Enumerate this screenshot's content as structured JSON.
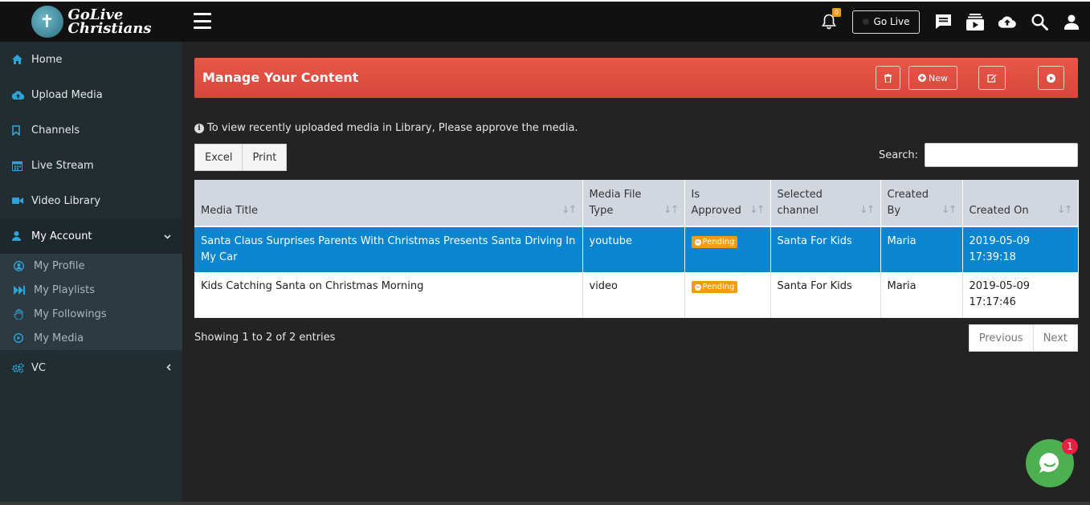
{
  "brand": {
    "logo_line1": "GoLive",
    "logo_line2": "Christians"
  },
  "sidebar": {
    "items": [
      {
        "label": "Home",
        "icon": "home-icon"
      },
      {
        "label": "Upload Media",
        "icon": "cloud-upload-icon"
      },
      {
        "label": "Channels",
        "icon": "bookmark-icon"
      },
      {
        "label": "Live Stream",
        "icon": "calendar-icon"
      },
      {
        "label": "Video Library",
        "icon": "video-camera-icon"
      },
      {
        "label": "My Account",
        "icon": "user-icon"
      }
    ],
    "submenu": [
      {
        "label": "My Profile",
        "icon": "user-circle-icon"
      },
      {
        "label": "My Playlists",
        "icon": "fast-forward-icon"
      },
      {
        "label": "My Followings",
        "icon": "hand-icon"
      },
      {
        "label": "My Media",
        "icon": "play-circle-icon"
      }
    ],
    "vc": {
      "label": "VC",
      "icon": "cogs-icon"
    }
  },
  "topbar": {
    "notification_count": "0",
    "golive_label": "Go Live"
  },
  "header": {
    "title": "Manage Your Content",
    "new_label": "New"
  },
  "notice": "To view recently uploaded media in Library, Please approve the media.",
  "tools": {
    "excel": "Excel",
    "print": "Print",
    "search_label": "Search:"
  },
  "table": {
    "headers": {
      "title": "Media Title",
      "type_1": "Media File",
      "type_2": "Type",
      "approved_1": "Is",
      "approved_2": "Approved",
      "channel_1": "Selected",
      "channel_2": "channel",
      "by_1": "Created",
      "by_2": "By",
      "on": "Created On"
    },
    "rows": [
      {
        "title": "Santa Claus Surprises Parents With Christmas Presents Santa Driving In My Car",
        "type": "youtube",
        "status": "Pending",
        "channel": "Santa For Kids",
        "by": "Maria",
        "date": "2019-05-09",
        "time": "17:39:18"
      },
      {
        "title": "Kids Catching Santa on Christmas Morning",
        "type": "video",
        "status": "Pending",
        "channel": "Santa For Kids",
        "by": "Maria",
        "date": "2019-05-09",
        "time": "17:17:46"
      }
    ]
  },
  "footer": {
    "showing": "Showing 1 to 2 of 2 entries",
    "previous": "Previous",
    "next": "Next"
  },
  "chat": {
    "badge": "1"
  },
  "colors": {
    "accent": "#2fa4d8",
    "header_red": "#dd4b39",
    "selected_row": "#0a85d0",
    "pending": "#f39c12",
    "chat_green": "#4caf50"
  }
}
